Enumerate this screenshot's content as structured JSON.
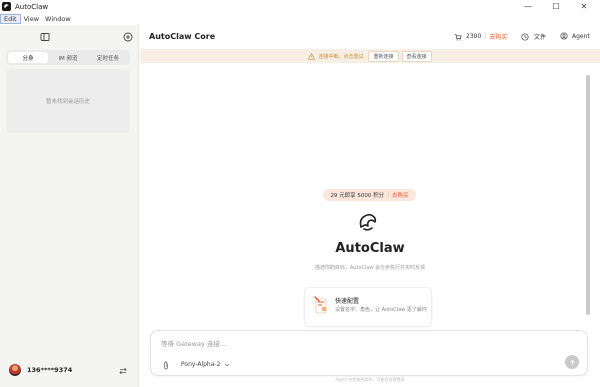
{
  "window": {
    "title": "AutoClaw",
    "minimize": "—",
    "maximize": "☐",
    "close": "✕"
  },
  "menu": {
    "items": [
      "Edit",
      "View",
      "Window"
    ]
  },
  "sidebar": {
    "tabs": [
      "分身",
      "IM 频道",
      "定时任务"
    ],
    "active_tab": 0,
    "empty_text": "暂未找到会话历史",
    "user": {
      "name": "136****9374"
    }
  },
  "header": {
    "title": "AutoClaw Core",
    "credits": "2300",
    "buy_label": "去购买",
    "files_label": "文件",
    "agent_label": "Agent"
  },
  "notice": {
    "text": "连接中断，点击重试",
    "reconnect_label": "重新连接",
    "view_label": "查看连接"
  },
  "main": {
    "promo_text": "29 元即享 5000 积分",
    "promo_buy": "去购买",
    "hero_title": "AutoClaw",
    "hero_subtitle": "描述你的目标，AutoClaw 会分步执行并实时反馈",
    "quick_card": {
      "title": "快速配置",
      "desc": "设置名字、角色，让 AutoClaw 更了解你"
    }
  },
  "composer": {
    "placeholder": "等待 Gateway 连接...",
    "model": "Pony-Alpha-2"
  },
  "footer": {
    "note": "Agent 在完成任务时，可能会出现错误"
  },
  "colors": {
    "accent": "#e85b2a",
    "notice_bg": "#f8efe4",
    "sidebar_bg": "#f4f4f2"
  }
}
